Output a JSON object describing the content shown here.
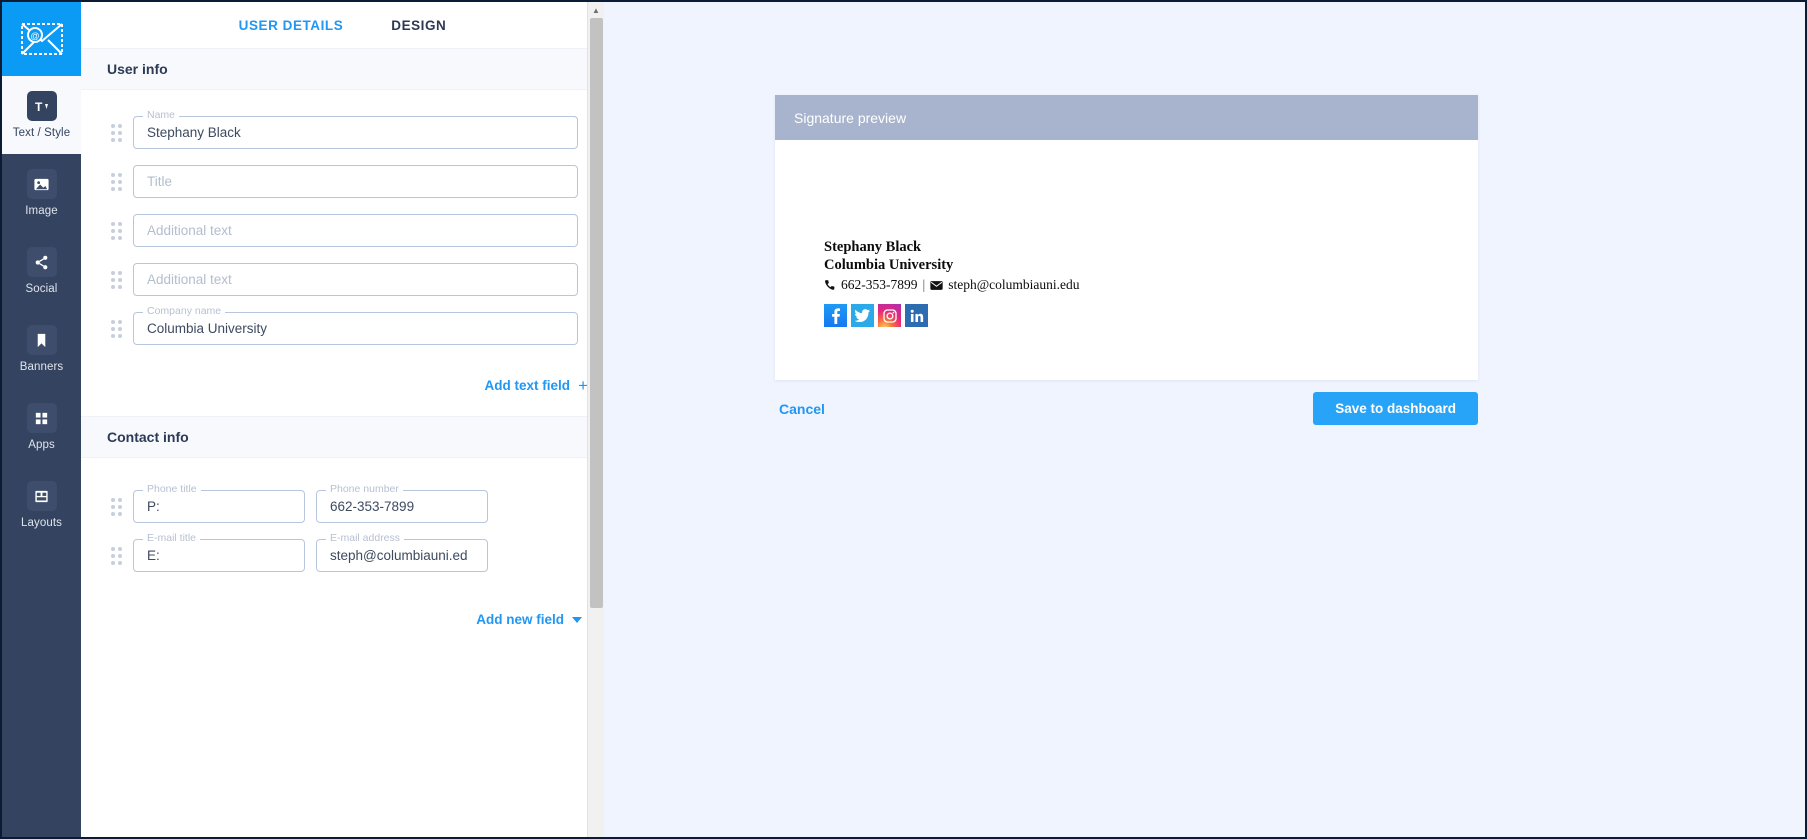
{
  "app": {
    "logo_icon": "envelope-at-icon",
    "accent_color": "#2196f3",
    "rail_color": "#34435f",
    "preview_bg": "#f0f4ff"
  },
  "sidebar": {
    "items": [
      {
        "label": "Text / Style",
        "icon": "text-style-icon",
        "active": true
      },
      {
        "label": "Image",
        "icon": "image-icon",
        "active": false
      },
      {
        "label": "Social",
        "icon": "share-icon",
        "active": false
      },
      {
        "label": "Banners",
        "icon": "bookmark-icon",
        "active": false
      },
      {
        "label": "Apps",
        "icon": "grid-apps-icon",
        "active": false
      },
      {
        "label": "Layouts",
        "icon": "layouts-icon",
        "active": false
      }
    ]
  },
  "tabs": [
    {
      "label": "USER DETAILS",
      "active": true
    },
    {
      "label": "DESIGN",
      "active": false
    }
  ],
  "user_info": {
    "section_title": "User info",
    "fields": [
      {
        "legend": "Name",
        "value": "Stephany Black",
        "placeholder": "Name",
        "filled": true
      },
      {
        "legend": "",
        "value": "",
        "placeholder": "Title",
        "filled": false
      },
      {
        "legend": "",
        "value": "",
        "placeholder": "Additional text",
        "filled": false
      },
      {
        "legend": "",
        "value": "",
        "placeholder": "Additional text",
        "filled": false
      },
      {
        "legend": "Company name",
        "value": "Columbia University",
        "placeholder": "Company name",
        "filled": true
      }
    ],
    "add_link": "Add text field",
    "add_icon": "plus-icon"
  },
  "contact_info": {
    "section_title": "Contact info",
    "rows": [
      {
        "title_legend": "Phone title",
        "title_value": "P:",
        "value_legend": "Phone number",
        "value_value": "662-353-7899"
      },
      {
        "title_legend": "E-mail title",
        "title_value": "E:",
        "value_legend": "E-mail address",
        "value_value": "steph@columbiauni.ed"
      }
    ],
    "add_link": "Add new field",
    "add_icon": "chevron-down-icon"
  },
  "preview": {
    "header": "Signature preview",
    "name": "Stephany Black",
    "company": "Columbia University",
    "phone_icon": "phone-icon",
    "phone": "662-353-7899",
    "separator": "|",
    "email_icon": "envelope-icon",
    "email": "steph@columbiauni.edu",
    "social": [
      {
        "name": "facebook-icon",
        "glyph": "f",
        "color": "#1877f2"
      },
      {
        "name": "twitter-icon",
        "glyph": "",
        "color": "#2ca9e8"
      },
      {
        "name": "instagram-icon",
        "glyph": "",
        "color": "#e5267c"
      },
      {
        "name": "linkedin-icon",
        "glyph": "in",
        "color": "#2d6cb0"
      }
    ]
  },
  "footer": {
    "cancel_label": "Cancel",
    "save_label": "Save to dashboard"
  }
}
